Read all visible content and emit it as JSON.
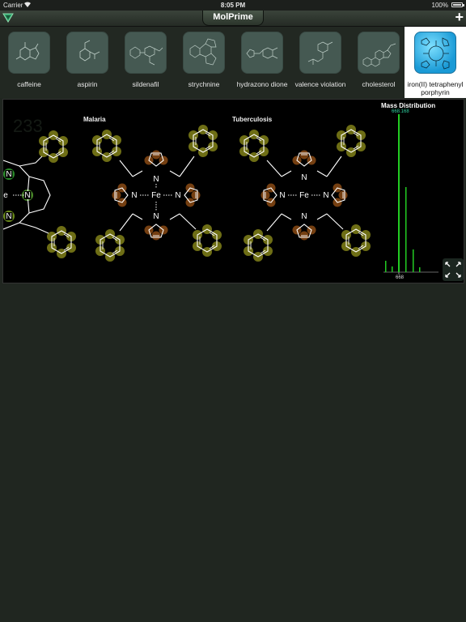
{
  "status_bar": {
    "carrier": "Carrier",
    "time": "8:05 PM",
    "battery": "100%"
  },
  "nav": {
    "title": "MolPrime",
    "menu_icon": "triangle-menu-icon",
    "add_icon": "plus-icon"
  },
  "molecules": [
    {
      "label": "caffeine"
    },
    {
      "label": "aspirin"
    },
    {
      "label": "sildenafil"
    },
    {
      "label": "strychnine"
    },
    {
      "label": "hydrazono dione"
    },
    {
      "label": "valence violation"
    },
    {
      "label": "cholesterol"
    },
    {
      "label": "iron(II) tetraphenyl porphyrin",
      "selected": true
    }
  ],
  "viewer": {
    "labels": {
      "malaria": "Malaria",
      "tuberculosis": "Tuberculosis"
    },
    "atom_labels": {
      "nitrogen": "N",
      "iron": "Fe"
    },
    "mass": {
      "title": "Mass Distribution",
      "peak_label": "668.168",
      "axis_label": "668"
    },
    "expand_icon": "expand-arrows-icon"
  },
  "colors": {
    "accent": "#1a9ad6",
    "bond": "#ffffff",
    "halo_yellow": "#8a8a1a",
    "halo_orange": "#8a4a14",
    "halo_red": "#8a2a10",
    "halo_green": "#2a8a2a",
    "mass_bar": "#22cc22"
  }
}
